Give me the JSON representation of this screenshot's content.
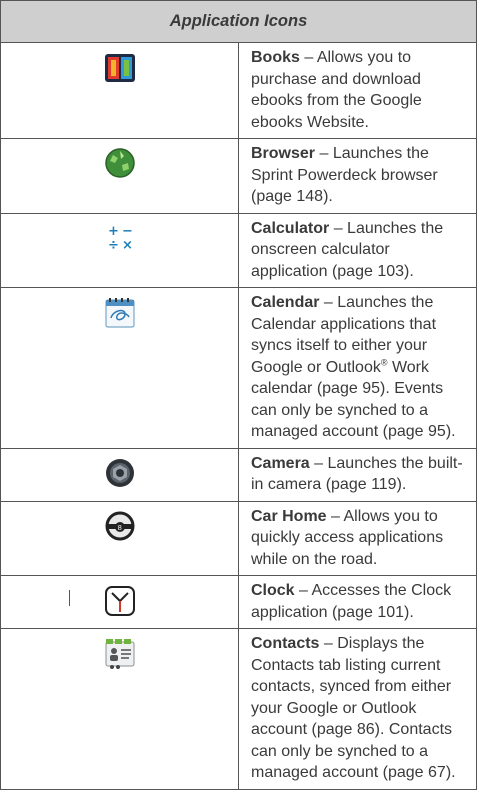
{
  "table_title": "Application Icons",
  "rows": [
    {
      "name": "Books",
      "desc": " – Allows you to purchase and download ebooks from the Google ebooks Website.",
      "icon": "books-icon"
    },
    {
      "name": "Browser",
      "desc": " – Launches the Sprint Powerdeck browser (page 148).",
      "icon": "browser-icon"
    },
    {
      "name": "Calculator",
      "desc": " – Launches the onscreen calculator application (page 103).",
      "icon": "calculator-icon"
    },
    {
      "name": "Calendar",
      "desc_a": " – Launches the Calendar applications that syncs itself to either your Google or Outlook",
      "sup": "®",
      "desc_b": " Work calendar (page 95). Events can only be synched to a managed account (page 95).",
      "icon": "calendar-icon"
    },
    {
      "name": "Camera",
      "desc": " – Launches the built-in camera (page 119).",
      "icon": "camera-icon"
    },
    {
      "name": "Car Home",
      "desc": " – Allows you to quickly access applications while on the road.",
      "icon": "car-home-icon"
    },
    {
      "name": "Clock",
      "desc": " – Accesses the Clock application (page 101).",
      "icon": "clock-icon"
    },
    {
      "name": "Contacts",
      "desc": " – Displays the Contacts tab listing current contacts, synced from either your Google or Outlook account (page 86). Contacts can only be synched to a managed account (page 67).",
      "icon": "contacts-icon"
    }
  ]
}
